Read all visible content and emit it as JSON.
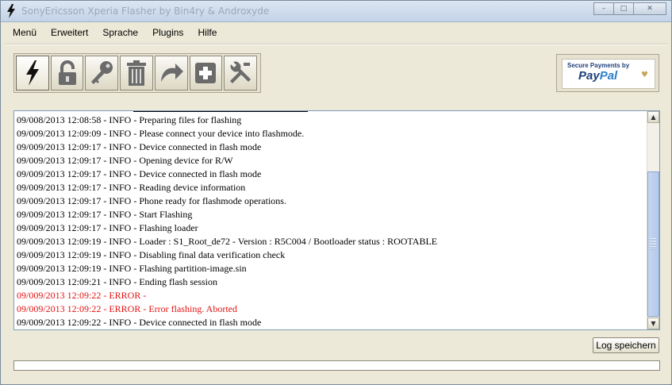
{
  "window": {
    "title": "SonyEricsson Xperia Flasher by Bin4ry & Androxyde"
  },
  "menubar": [
    "Menü",
    "Erweitert",
    "Sprache",
    "Plugins",
    "Hilfe"
  ],
  "toolbar": {
    "icons": [
      "flash-icon",
      "unlock-icon",
      "key-icon",
      "trash-icon",
      "redo-arrow-icon",
      "add-icon",
      "wrench-icon"
    ]
  },
  "paypal": {
    "line1": "Secure Payments by",
    "brand_pay": "Pay",
    "brand_pal": "Pal"
  },
  "log": {
    "lines": [
      {
        "text": "09/008/2013 12:08:58 - INFO  - Preparing files for flashing",
        "level": "info"
      },
      {
        "text": "09/009/2013 12:09:09 - INFO  - Please connect your device into flashmode.",
        "level": "info"
      },
      {
        "text": "09/009/2013 12:09:17 - INFO  - Device connected in flash mode",
        "level": "info"
      },
      {
        "text": "09/009/2013 12:09:17 - INFO  - Opening device for R/W",
        "level": "info"
      },
      {
        "text": "09/009/2013 12:09:17 - INFO  - Device connected in flash mode",
        "level": "info"
      },
      {
        "text": "09/009/2013 12:09:17 - INFO  - Reading device information",
        "level": "info"
      },
      {
        "text": "09/009/2013 12:09:17 - INFO  - Phone ready for flashmode operations.",
        "level": "info"
      },
      {
        "text": "09/009/2013 12:09:17 - INFO  - Start Flashing",
        "level": "info"
      },
      {
        "text": "09/009/2013 12:09:17 - INFO  - Flashing loader",
        "level": "info"
      },
      {
        "text": "09/009/2013 12:09:19 - INFO  - Loader : S1_Root_de72 - Version : R5C004 / Bootloader status : ROOTABLE",
        "level": "info"
      },
      {
        "text": "09/009/2013 12:09:19 - INFO  - Disabling final data verification check",
        "level": "info"
      },
      {
        "text": "09/009/2013 12:09:19 - INFO  - Flashing partition-image.sin",
        "level": "info"
      },
      {
        "text": "09/009/2013 12:09:21 - INFO  - Ending flash session",
        "level": "info"
      },
      {
        "text": "09/009/2013 12:09:22 - ERROR -",
        "level": "error"
      },
      {
        "text": "09/009/2013 12:09:22 - ERROR - Error flashing. Aborted",
        "level": "error"
      },
      {
        "text": "09/009/2013 12:09:22 - INFO  - Device connected in flash mode",
        "level": "info"
      }
    ]
  },
  "buttons": {
    "save_log": "Log speichern"
  },
  "progress": {
    "value": 0
  },
  "colors": {
    "error": "#e21212",
    "background": "#ece9d8"
  }
}
